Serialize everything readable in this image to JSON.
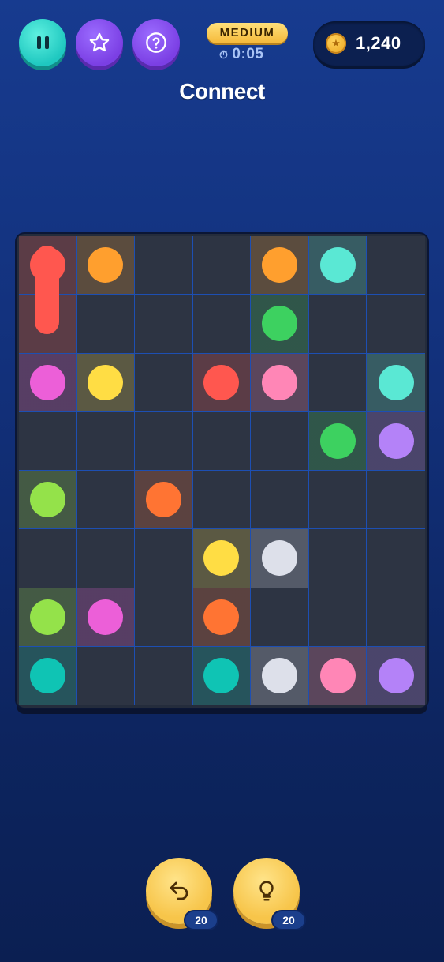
{
  "header": {
    "difficulty": "MEDIUM",
    "timer": "0:05",
    "coins": "1,240",
    "buttons": [
      "pause-icon",
      "star-icon",
      "help-icon"
    ]
  },
  "title": "Connect",
  "colors": {
    "red": "#ff574f",
    "orange": "#ff9f2e",
    "teal": "#5ae8d4",
    "green": "#3dd160",
    "magenta": "#ec5fd8",
    "yellow": "#ffdd44",
    "pink": "#ff86b6",
    "purple": "#b482f8",
    "lime": "#94e24a",
    "dark-orange": "#ff7433",
    "white": "#dde0ea",
    "cyan": "#0fc4b4"
  },
  "board": {
    "columns": 7,
    "rows": 8,
    "cells": [
      [
        "red",
        "orange",
        "",
        "",
        "orange",
        "teal",
        ""
      ],
      [
        "red-path",
        "",
        "",
        "",
        "green",
        "",
        ""
      ],
      [
        "magenta",
        "yellow",
        "",
        "red",
        "pink",
        "",
        "teal"
      ],
      [
        "",
        "",
        "",
        "",
        "",
        "green",
        "purple"
      ],
      [
        "lime",
        "",
        "dark-orange",
        "",
        "",
        "",
        ""
      ],
      [
        "",
        "",
        "",
        "yellow",
        "white",
        "",
        ""
      ],
      [
        "lime",
        "magenta",
        "",
        "dark-orange",
        "",
        "",
        ""
      ],
      [
        "cyan",
        "",
        "",
        "cyan",
        "white",
        "pink",
        "purple"
      ]
    ]
  },
  "tools": {
    "undo": {
      "icon": "undo-icon",
      "count": "20"
    },
    "hint": {
      "icon": "lightbulb-icon",
      "count": "20"
    }
  }
}
